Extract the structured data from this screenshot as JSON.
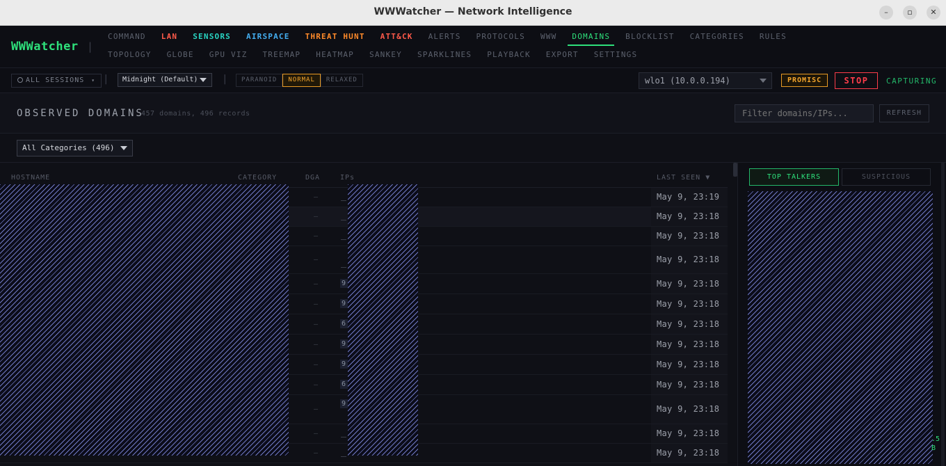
{
  "window": {
    "title": "WWWatcher — Network Intelligence",
    "controls": [
      "–",
      "▫",
      "✕"
    ]
  },
  "app": {
    "logo": "WWWatcher"
  },
  "nav": {
    "row1": [
      {
        "label": "COMMAND",
        "style": "default"
      },
      {
        "label": "LAN",
        "style": "red"
      },
      {
        "label": "SENSORS",
        "style": "cyan"
      },
      {
        "label": "AIRSPACE",
        "style": "blue"
      },
      {
        "label": "THREAT HUNT",
        "style": "orange"
      },
      {
        "label": "ATT&CK",
        "style": "red"
      },
      {
        "label": "ALERTS",
        "style": "default"
      },
      {
        "label": "PROTOCOLS",
        "style": "default"
      },
      {
        "label": "WWW",
        "style": "default"
      },
      {
        "label": "DOMAINS",
        "style": "active"
      },
      {
        "label": "BLOCKLIST",
        "style": "default"
      },
      {
        "label": "CATEGORIES",
        "style": "default"
      },
      {
        "label": "RULES",
        "style": "default"
      }
    ],
    "row2": [
      {
        "label": "TOPOLOGY"
      },
      {
        "label": "GLOBE"
      },
      {
        "label": "GPU VIZ"
      },
      {
        "label": "TREEMAP"
      },
      {
        "label": "HEATMAP"
      },
      {
        "label": "SANKEY"
      },
      {
        "label": "SPARKLINES"
      },
      {
        "label": "PLAYBACK"
      },
      {
        "label": "EXPORT"
      },
      {
        "label": "SETTINGS"
      }
    ]
  },
  "toolbar": {
    "sessions_label": "ALL SESSIONS",
    "sessions_caret": "▾",
    "theme": "Midnight (Default)",
    "modes": [
      {
        "label": "PARANOID",
        "active": false
      },
      {
        "label": "NORMAL",
        "active": true
      },
      {
        "label": "RELAXED",
        "active": false
      }
    ],
    "interface": "wlo1 (10.0.0.194)",
    "promisc": "PROMISC",
    "stop": "STOP",
    "status": "CAPTURING"
  },
  "section": {
    "title": "OBSERVED DOMAINS",
    "subtitle": "457 domains, 496 records",
    "filter_placeholder": "Filter domains/IPs...",
    "refresh": "REFRESH",
    "category_filter": "All Categories (496)"
  },
  "table": {
    "headers": {
      "hostname": "HOSTNAME",
      "category": "CATEGORY",
      "dga": "DGA",
      "ips": "IPs",
      "last_seen": "LAST SEEN ▼"
    },
    "rows": [
      {
        "dga": "—",
        "ip": "",
        "last_seen": "May 9, 23:19"
      },
      {
        "dga": "—",
        "ip": "",
        "last_seen": "May 9, 23:18"
      },
      {
        "dga": "—",
        "ip": "",
        "last_seen": "May 9, 23:18"
      },
      {
        "dga": "—",
        "ip": "",
        "last_seen": "May 9, 23:18"
      },
      {
        "dga": "—",
        "ip": "9",
        "last_seen": "May 9, 23:18"
      },
      {
        "dga": "—",
        "ip": "9",
        "last_seen": "May 9, 23:18"
      },
      {
        "dga": "—",
        "ip": "6",
        "last_seen": "May 9, 23:18"
      },
      {
        "dga": "—",
        "ip": "9",
        "last_seen": "May 9, 23:18"
      },
      {
        "dga": "—",
        "ip": "9",
        "last_seen": "May 9, 23:18"
      },
      {
        "dga": "—",
        "ip": "6",
        "last_seen": "May 9, 23:18"
      },
      {
        "dga": "—",
        "ip": "9",
        "last_seen": "May 9, 23:18"
      },
      {
        "dga": "—",
        "ip": "",
        "last_seen": "May 9, 23:18"
      },
      {
        "dga": "—",
        "ip": "",
        "last_seen": "May 9, 23:18"
      }
    ]
  },
  "side": {
    "tabs": [
      {
        "label": "TOP TALKERS",
        "active": true
      },
      {
        "label": "SUSPICIOUS",
        "active": false
      }
    ],
    "visible_values": [
      ".5",
      "B"
    ]
  }
}
